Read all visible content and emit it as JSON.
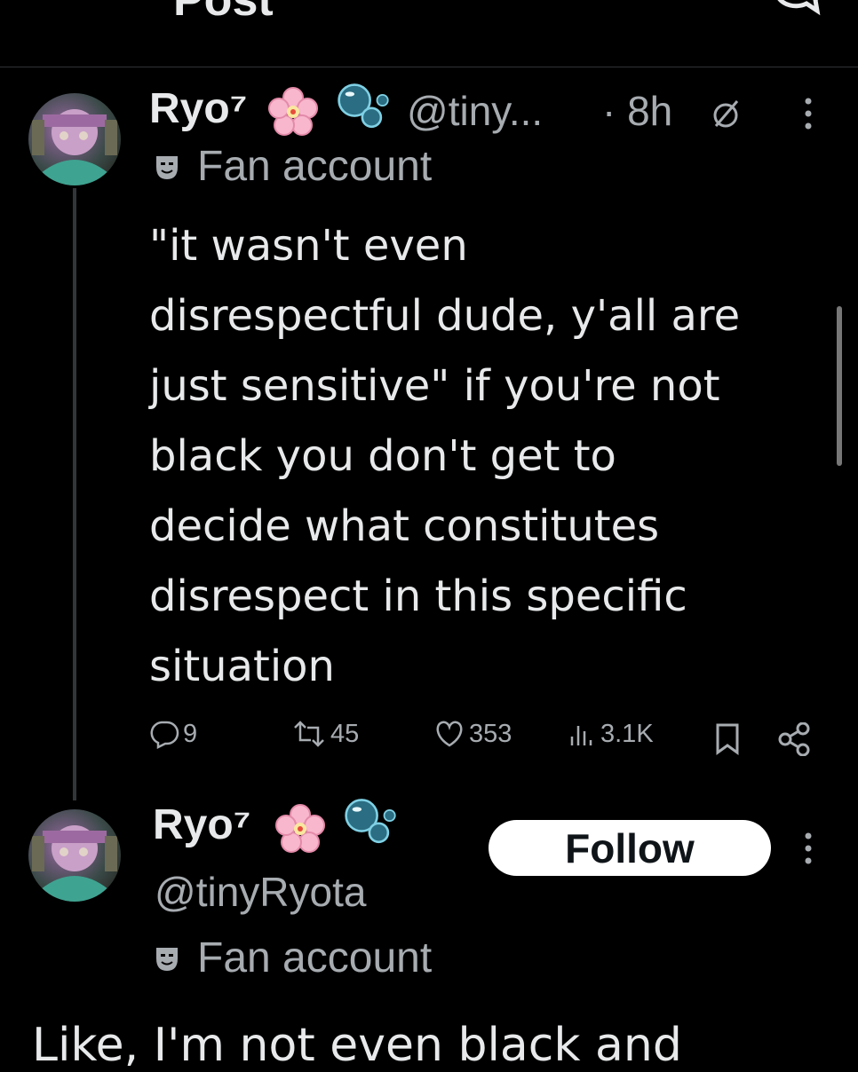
{
  "header": {
    "title": "Post"
  },
  "post": {
    "display_name": "Ryo⁷",
    "handle": "@tiny...",
    "time": "· 8h",
    "badge": "Fan account",
    "text": "\"it wasn't even\ndisrespectful dude, y'all are\njust sensitive\" if you're not\nblack you don't get to\ndecide what constitutes\ndisrespect in this specific\nsituation",
    "stats": {
      "replies": "9",
      "reposts": "45",
      "likes": "353",
      "views": "3.1K"
    }
  },
  "reply": {
    "display_name": "Ryo⁷",
    "handle": "@tinyRyota",
    "badge": "Fan account",
    "follow_label": "Follow",
    "text_partial": "Like, I'm not even black and"
  },
  "colors": {
    "background": "#000000",
    "text": "#e7e9ea",
    "secondary": "#a7acb1",
    "divider": "#2f3336"
  }
}
